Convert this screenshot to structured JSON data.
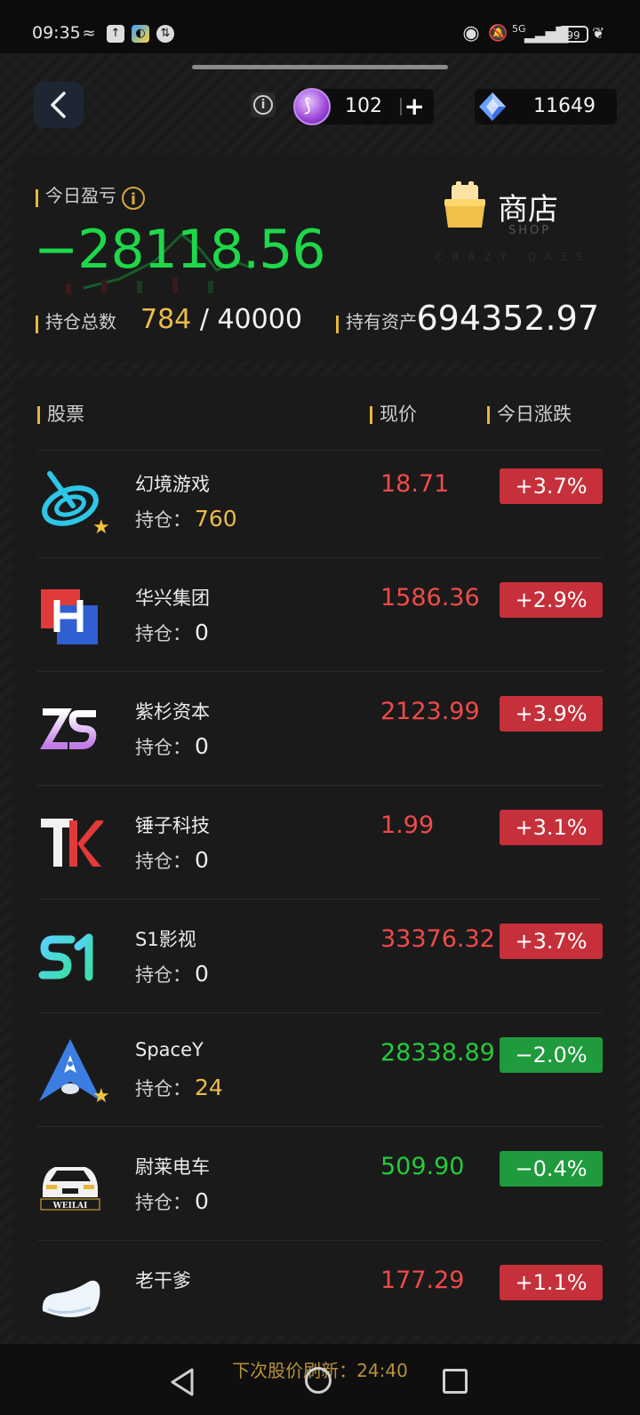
{
  "status_bar": {
    "time": "09:35",
    "network": "5G",
    "battery": "99"
  },
  "top_bar": {
    "coins": "102",
    "coin_add": "+",
    "gems": "11649"
  },
  "summary": {
    "today_pnl_label": "今日盈亏",
    "today_pnl_value": "−28118.56",
    "holding_label": "持仓总数",
    "holding_count": "784",
    "holding_separator": "/",
    "holding_limit": "40000",
    "assets_label": "持有资产",
    "assets_value": "694352.97",
    "shop_label": "商店",
    "shop_sub": "SHOP",
    "watermark": "CRAZY DAES"
  },
  "list": {
    "headers": {
      "stock": "股票",
      "price": "现价",
      "change": "今日涨跌"
    },
    "hold_prefix": "持仓：",
    "stocks": [
      {
        "name": "幻境游戏",
        "holding": "760",
        "price": "18.71",
        "change": "+3.7%",
        "direction": "up",
        "starred": true,
        "icon": "fantasy-game-logo-icon"
      },
      {
        "name": "华兴集团",
        "holding": "0",
        "price": "1586.36",
        "change": "+2.9%",
        "direction": "up",
        "starred": false,
        "icon": "huaxing-logo-icon"
      },
      {
        "name": "紫杉资本",
        "holding": "0",
        "price": "2123.99",
        "change": "+3.9%",
        "direction": "up",
        "starred": false,
        "icon": "zs-logo-icon"
      },
      {
        "name": "锤子科技",
        "holding": "0",
        "price": "1.99",
        "change": "+3.1%",
        "direction": "up",
        "starred": false,
        "icon": "hammer-tk-logo-icon"
      },
      {
        "name": "S1影视",
        "holding": "0",
        "price": "33376.32",
        "change": "+3.7%",
        "direction": "up",
        "starred": false,
        "icon": "s1-logo-icon"
      },
      {
        "name": "SpaceY",
        "holding": "24",
        "price": "28338.89",
        "change": "−2.0%",
        "direction": "down",
        "starred": true,
        "icon": "rocket-logo-icon"
      },
      {
        "name": "尉莱电车",
        "holding": "0",
        "price": "509.90",
        "change": "−0.4%",
        "direction": "down",
        "starred": false,
        "icon": "weilai-car-logo-icon",
        "logo_text": "WEILAI"
      },
      {
        "name": "老干爹",
        "holding": "",
        "price": "177.29",
        "change": "+1.1%",
        "direction": "up",
        "starred": false,
        "icon": "laoganda-logo-icon"
      }
    ]
  },
  "footer": {
    "refresh_label": "下次股价刷新：",
    "refresh_countdown": "24:40"
  },
  "colors": {
    "up": "#f04a4a",
    "down": "#22cc3a",
    "accent_gold": "#ecbb4a"
  }
}
